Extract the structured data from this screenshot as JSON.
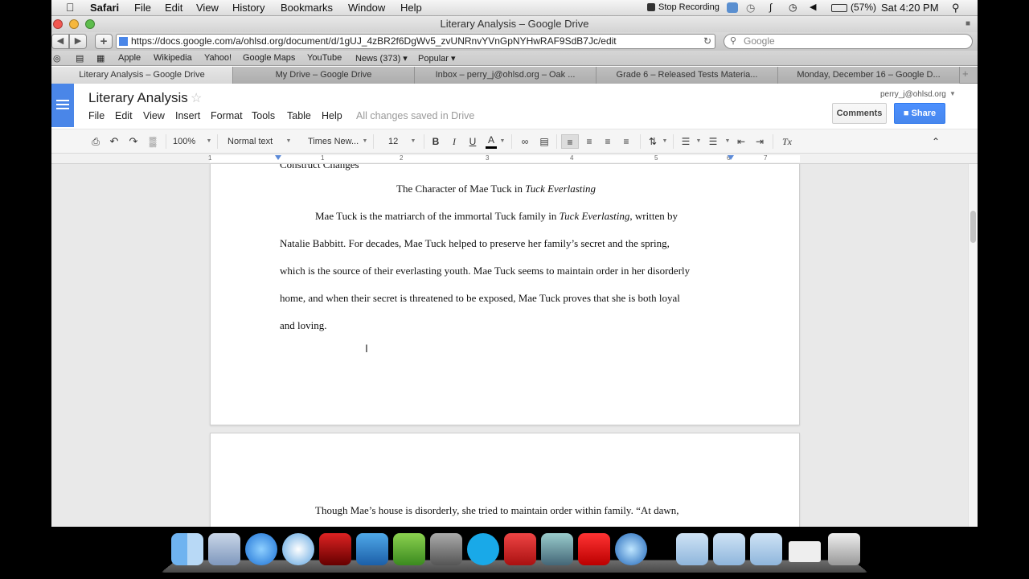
{
  "menubar": {
    "apple": "",
    "app": "Safari",
    "items": [
      "File",
      "Edit",
      "View",
      "History",
      "Bookmarks",
      "Window",
      "Help"
    ],
    "recording": "Stop Recording",
    "battery": "(57%)",
    "clock": "Sat 4:20 PM"
  },
  "window": {
    "title": "Literary Analysis – Google Drive"
  },
  "address": {
    "url": "https://docs.google.com/a/ohlsd.org/document/d/1gUJ_4zBR2f6DgWv5_zvUNRnvYVnGpNYHwRAF9SdB7Jc/edit",
    "search_placeholder": "Google"
  },
  "bookmarks": [
    "Apple",
    "Wikipedia",
    "Yahoo!",
    "Google Maps",
    "YouTube",
    "News (373) ▾",
    "Popular ▾"
  ],
  "tabs": [
    "Literary Analysis – Google Drive",
    "My Drive – Google Drive",
    "Inbox – perry_j@ohlsd.org – Oak ...",
    "Grade 6 – Released Tests Materia...",
    "Monday, December 16 – Google D..."
  ],
  "docs": {
    "title": "Literary Analysis",
    "menu": [
      "File",
      "Edit",
      "View",
      "Insert",
      "Format",
      "Tools",
      "Table",
      "Help"
    ],
    "saved_status": "All changes saved in Drive",
    "user": "perry_j@ohlsd.org",
    "comments_label": "Comments",
    "share_label": "Share"
  },
  "toolbar": {
    "zoom": "100%",
    "style": "Normal text",
    "font": "Times New...",
    "size": "12",
    "bold": "B",
    "italic": "I",
    "underline": "U",
    "text_color": "A",
    "clear": "Tx"
  },
  "ruler": [
    "1",
    "1",
    "2",
    "3",
    "4",
    "5",
    "6",
    "7"
  ],
  "document": {
    "cut_line": "Construct Changes",
    "heading_prefix": "The Character of Mae Tuck in ",
    "heading_italic": "Tuck Everlasting",
    "p1_l1_a": "Mae Tuck is the matriarch of the immortal Tuck family in ",
    "p1_l1_b": "Tuck Everlasting",
    "p1_l1_c": ", written by",
    "p1_l2": "Natalie Babbitt.  For decades, Mae Tuck helped to preserve her family’s secret and the spring,",
    "p1_l3": "which is the source of their everlasting youth.  Mae Tuck seems to maintain order in her disorderly",
    "p1_l4": "home, and when their secret is threatened to be exposed, Mae Tuck  proves that she is both loyal",
    "p1_l5": "and loving.",
    "p2_l1": "Though Mae’s house is disorderly, she tried to maintain order within family.  “At dawn,"
  },
  "dock_icons": [
    "finder-icon",
    "mail-icon",
    "itunes-icon",
    "safari-icon",
    "photo-booth-icon",
    "word-icon",
    "app-icon",
    "system-preferences-icon",
    "skype-icon",
    "angry-birds-icon",
    "iphoto-icon",
    "acrobat-icon",
    "quicktime-icon",
    "applications-folder-icon",
    "documents-folder-icon",
    "downloads-folder-icon",
    "screen-icon",
    "trash-icon"
  ],
  "colors": {
    "docs_blue": "#4a86e8",
    "share_blue": "#4d90fe"
  }
}
